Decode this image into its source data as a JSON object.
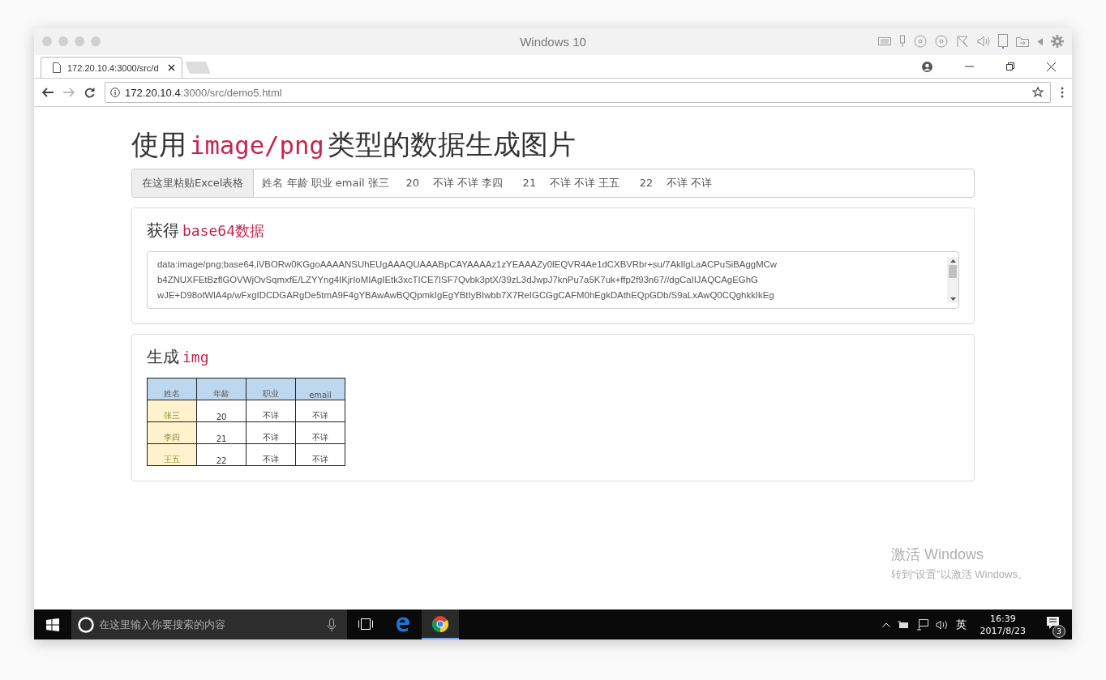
{
  "vm_window": {
    "title": "Windows 10"
  },
  "browser": {
    "tab": {
      "title": "172.20.10.4:3000/src/d"
    },
    "address": {
      "host": "172.20.10.4",
      "path": ":3000/src/demo5.html"
    }
  },
  "page": {
    "heading": [
      {
        "kind": "text",
        "text": "使用"
      },
      {
        "kind": "code",
        "text": "image/png"
      },
      {
        "kind": "text",
        "text": "类型的数据生成图片"
      }
    ],
    "paste": {
      "label": "在这里粘贴Excel表格",
      "value": "姓名 年龄 职业 email 张三     20    不详 不详 李四      21    不详 不详 王五      22    不详 不详"
    },
    "panels": [
      {
        "kind": "textarea",
        "title": [
          {
            "kind": "text",
            "text": "获得"
          },
          {
            "kind": "code",
            "text": "base64数据"
          }
        ],
        "lines": [
          "data:image/png;base64,iVBORw0KGgoAAAANSUhEUgAAAQUAAABpCAYAAAAz1zYEAAAZy0lEQVR4Ae1dCXBVRbr+su/7AklIgLaACPuSiBAggMCw",
          "b4ZNUXFEtBzflGOVWjOvSqmxfE/LZYYng4IKjrIoMIAgIEtk3xcTICE7ISF7Qvbk3ptX/39zL3dJwpJ7knPu7a5K7uk+ffp2f93n67//dgCaIIJAQCAgEGhG",
          "wJE+D98otWlA4p/wFxgIDCDGARgDe5tmA9F4gYBAwAwBQQpmkIgEgYBtIyBIwbb7X7ReIGCGgCAFM0hEgkDAthEQpGDb/S9aLxAwQ0CQghkkIkEg"
        ]
      },
      {
        "kind": "table",
        "title": [
          {
            "kind": "text",
            "text": "生成"
          },
          {
            "kind": "code",
            "text": "img"
          }
        ],
        "columns": [
          "姓名",
          "年龄",
          "职业",
          "email"
        ],
        "rows": [
          [
            "张三",
            "20",
            "不详",
            "不详"
          ],
          [
            "李四",
            "21",
            "不详",
            "不详"
          ],
          [
            "王五",
            "22",
            "不详",
            "不详"
          ]
        ]
      }
    ]
  },
  "activation": {
    "title": "激活 Windows",
    "hint": "转到“设置”以激活 Windows。"
  },
  "taskbar": {
    "search": {
      "placeholder": "在这里输入你要搜索的内容"
    },
    "apps": [
      {
        "kind": "task-view",
        "selected": false
      },
      {
        "kind": "edge",
        "selected": false
      },
      {
        "kind": "chrome",
        "selected": true
      }
    ],
    "ime": "英",
    "time": "16:39",
    "date": "2017/8/23",
    "notifications": "3"
  }
}
